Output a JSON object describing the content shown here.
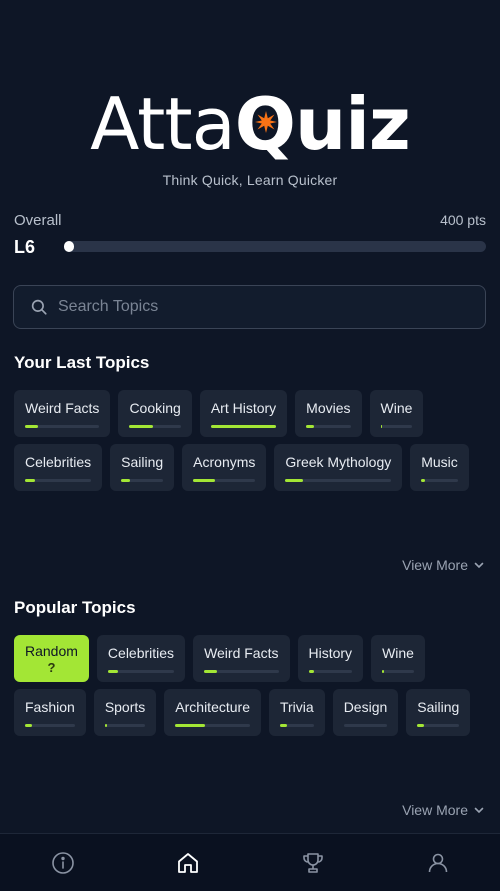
{
  "app": {
    "logo_part1": "Atta",
    "logo_q": "Q",
    "logo_part2": "uiz",
    "tagline": "Think Quick, Learn Quicker"
  },
  "progress": {
    "label": "Overall",
    "points": "400 pts",
    "level": "L6",
    "fill_fraction": 0.0
  },
  "search": {
    "placeholder": "Search Topics"
  },
  "last_topics": {
    "title": "Your Last Topics",
    "view_more": "View More",
    "items": [
      {
        "label": "Weird Facts",
        "progress": 0.18
      },
      {
        "label": "Cooking",
        "progress": 0.45
      },
      {
        "label": "Art History",
        "progress": 1.0
      },
      {
        "label": "Movies",
        "progress": 0.18
      },
      {
        "label": "Wine",
        "progress": 0.05
      },
      {
        "label": "Celebrities",
        "progress": 0.15
      },
      {
        "label": "Sailing",
        "progress": 0.2
      },
      {
        "label": "Acronyms",
        "progress": 0.35
      },
      {
        "label": "Greek Mythology",
        "progress": 0.17
      },
      {
        "label": "Music",
        "progress": 0.1
      }
    ]
  },
  "popular_topics": {
    "title": "Popular Topics",
    "view_more": "View More",
    "random": {
      "label": "Random",
      "symbol": "?"
    },
    "items": [
      {
        "label": "Celebrities",
        "progress": 0.15
      },
      {
        "label": "Weird Facts",
        "progress": 0.18
      },
      {
        "label": "History",
        "progress": 0.12
      },
      {
        "label": "Wine",
        "progress": 0.05
      },
      {
        "label": "Fashion",
        "progress": 0.15
      },
      {
        "label": "Sports",
        "progress": 0.05
      },
      {
        "label": "Architecture",
        "progress": 0.4
      },
      {
        "label": "Trivia",
        "progress": 0.22
      },
      {
        "label": "Design",
        "progress": 0.0
      },
      {
        "label": "Sailing",
        "progress": 0.15
      }
    ]
  },
  "nav": {
    "items": [
      {
        "icon": "info-icon"
      },
      {
        "icon": "home-icon",
        "active": true
      },
      {
        "icon": "trophy-icon"
      },
      {
        "icon": "user-icon"
      }
    ]
  },
  "colors": {
    "background": "#0e1626",
    "accent": "#a3e635",
    "logo_star": "#f97316",
    "chip": "#1d2636"
  }
}
